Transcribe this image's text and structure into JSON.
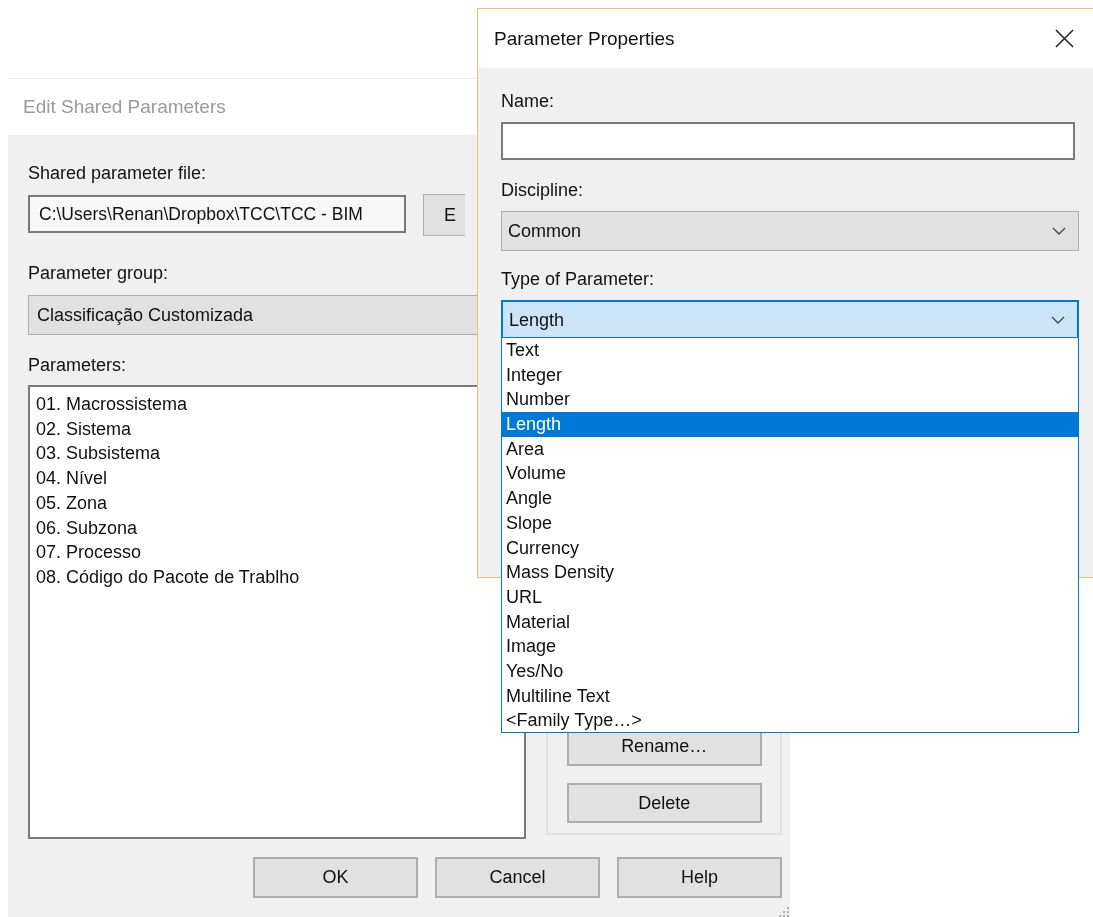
{
  "back_dialog": {
    "title": "Edit Shared Parameters",
    "file_label": "Shared parameter file:",
    "file_path": "C:\\Users\\Renan\\Dropbox\\TCC\\TCC - BIM",
    "browse_button": "E",
    "group_label": "Parameter group:",
    "group_value": "Classificação Customizada",
    "parameters_label": "Parameters:",
    "parameters": [
      "01. Macrossistema",
      "02. Sistema",
      "03. Subsistema",
      "04. Nível",
      "05. Zona",
      "06. Subzona",
      "07. Processo",
      "08. Código do Pacote de Trablho"
    ],
    "side_buttons": [
      "Rename…",
      "Delete"
    ],
    "buttons": [
      "OK",
      "Cancel",
      "Help"
    ]
  },
  "front_dialog": {
    "title": "Parameter Properties",
    "name_label": "Name:",
    "discipline_label": "Discipline:",
    "discipline_value": "Common",
    "type_label": "Type of Parameter:",
    "type_value": "Length",
    "type_options": [
      {
        "label": "Text",
        "selected": false
      },
      {
        "label": "Integer",
        "selected": false
      },
      {
        "label": "Number",
        "selected": false
      },
      {
        "label": "Length",
        "selected": true
      },
      {
        "label": "Area",
        "selected": false
      },
      {
        "label": "Volume",
        "selected": false
      },
      {
        "label": "Angle",
        "selected": false
      },
      {
        "label": "Slope",
        "selected": false
      },
      {
        "label": "Currency",
        "selected": false
      },
      {
        "label": "Mass Density",
        "selected": false
      },
      {
        "label": "URL",
        "selected": false
      },
      {
        "label": "Material",
        "selected": false
      },
      {
        "label": "Image",
        "selected": false
      },
      {
        "label": "Yes/No",
        "selected": false
      },
      {
        "label": "Multiline Text",
        "selected": false
      },
      {
        "label": "<Family Type…>",
        "selected": false
      }
    ]
  }
}
